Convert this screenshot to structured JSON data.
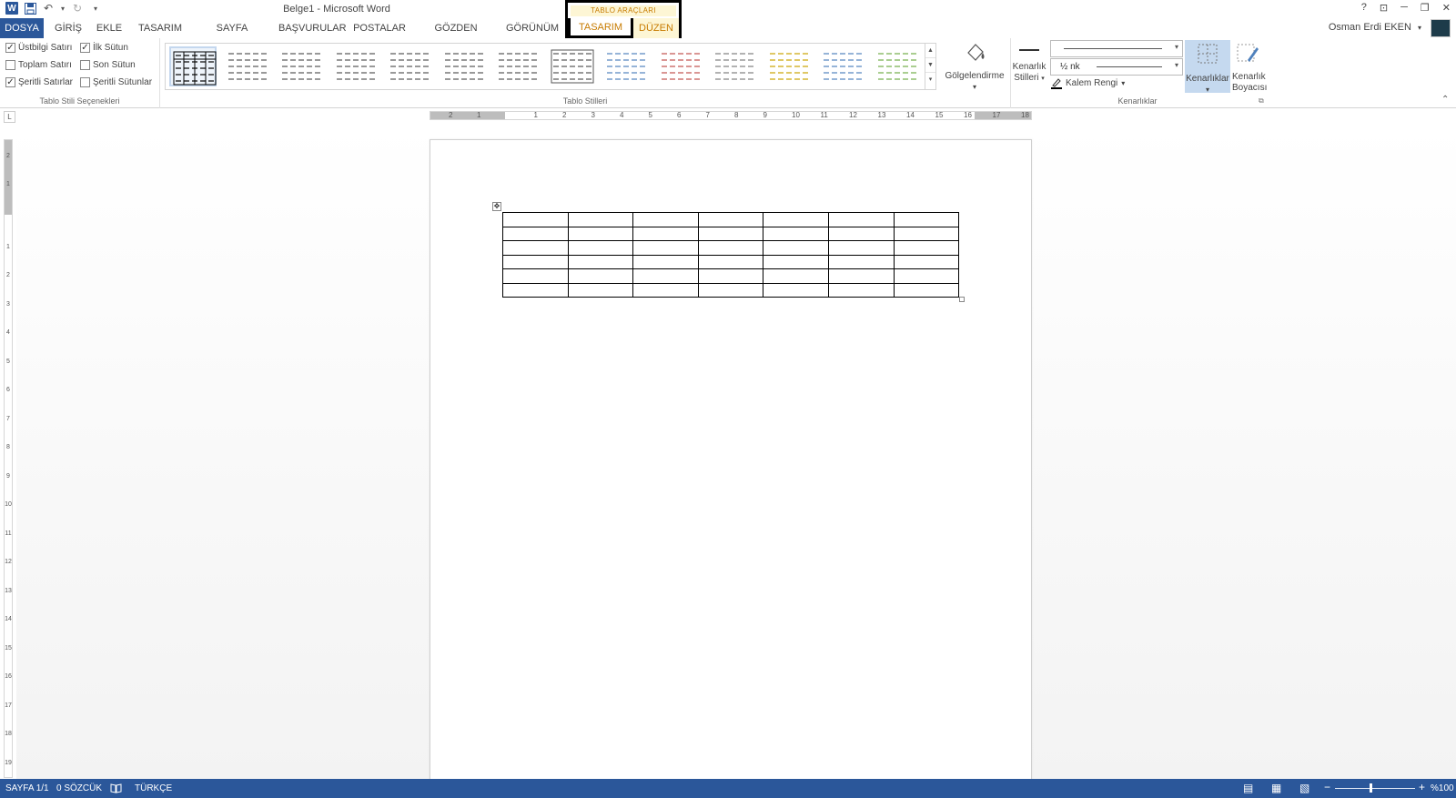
{
  "titlebar": {
    "title": "Belge1 - Microsoft Word",
    "qat": {
      "word": "W",
      "save": "💾",
      "undo": "↶",
      "undo_arrow": "▾",
      "redo": "↻",
      "customize": "▾"
    },
    "controls": {
      "help": "?",
      "ribbon_opts": "⊡",
      "minimize": "─",
      "restore": "❐",
      "close": "✕"
    }
  },
  "context_group": {
    "title": "TABLO ARAÇLARI"
  },
  "tabs": {
    "file": "DOSYA",
    "items": [
      "GİRİŞ",
      "EKLE",
      "TASARIM",
      "SAYFA DÜZENİ",
      "BAŞVURULAR",
      "POSTALAR",
      "GÖZDEN GEÇİR",
      "GÖRÜNÜM"
    ],
    "ctx_design": "TASARIM",
    "ctx_layout": "DÜZEN"
  },
  "user": {
    "name": "Osman Erdi EKEN",
    "arrow": "▾"
  },
  "ribbon": {
    "style_options": {
      "label": "Tablo Stili Seçenekleri",
      "header_row": {
        "label": "Üstbilgi Satırı",
        "checked": "✓"
      },
      "total_row": {
        "label": "Toplam Satırı",
        "checked": ""
      },
      "banded_rows": {
        "label": "Şeritli Satırlar",
        "checked": "✓"
      },
      "first_column": {
        "label": "İlk Sütun",
        "checked": "✓"
      },
      "last_column": {
        "label": "Son Sütun",
        "checked": ""
      },
      "banded_columns": {
        "label": "Şeritli Sütunlar",
        "checked": ""
      }
    },
    "table_styles": {
      "label": "Tablo Stilleri",
      "scroll_up": "▲",
      "scroll_down": "▼",
      "more": "▾",
      "thumb_colors": [
        "#000000",
        "#555555",
        "#555555",
        "#555555",
        "#555555",
        "#555555",
        "#555555",
        "#555555",
        "#4f81bd",
        "#c0504d",
        "#7f7f7f",
        "#c9a400",
        "#4f81bd",
        "#70ad47"
      ]
    },
    "shading": {
      "label": "Gölgelendirme",
      "arrow": "▾",
      "icon": "paint-bucket"
    },
    "borders_group": {
      "label": "Kenarlıklar",
      "border_styles": {
        "line1": "Kenarlık",
        "line2": "Stilleri",
        "arrow": "▾"
      },
      "line_weight": "½ nk",
      "pen_color": "Kalem Rengi",
      "pen_arrow": "▾",
      "borders_btn": "Kenarlıklar",
      "borders_arrow": "▾",
      "painter": {
        "line1": "Kenarlık",
        "line2": "Boyacısı"
      },
      "launcher": "⧉",
      "collapse": "⌃"
    }
  },
  "ruler": {
    "tab_selector": "L",
    "h_numbers": [
      "2",
      "1",
      "1",
      "2",
      "3",
      "4",
      "5",
      "6",
      "7",
      "8",
      "9",
      "10",
      "11",
      "12",
      "13",
      "14",
      "15",
      "16",
      "17",
      "18"
    ],
    "v_numbers": [
      "2",
      "1",
      "1",
      "2",
      "3",
      "4",
      "5",
      "6",
      "7",
      "8",
      "9",
      "10",
      "11",
      "12",
      "13",
      "14",
      "15",
      "16",
      "17",
      "18",
      "19"
    ]
  },
  "document": {
    "table": {
      "rows": 6,
      "cols": 7
    },
    "move_handle": "✥"
  },
  "statusbar": {
    "page": "SAYFA 1/1",
    "words": "0 SÖZCÜK",
    "proof_icon": "📖",
    "language": "TÜRKÇE",
    "view_read": "▤",
    "view_print": "▦",
    "view_web": "▧",
    "zoom_minus": "−",
    "zoom_plus": "+",
    "zoom": "%100"
  }
}
